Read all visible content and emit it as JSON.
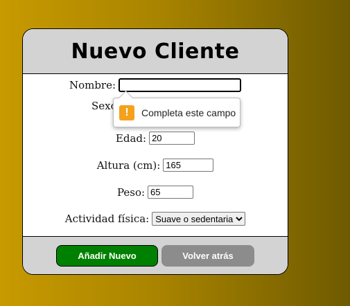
{
  "form": {
    "title": "Nuevo Cliente",
    "fields": {
      "nombre": {
        "label": "Nombre:",
        "value": ""
      },
      "sexo": {
        "label": "Sexo"
      },
      "edad": {
        "label": "Edad:",
        "value": "20"
      },
      "altura": {
        "label": "Altura (cm):",
        "value": "165"
      },
      "peso": {
        "label": "Peso:",
        "value": "65"
      },
      "actividad": {
        "label": "Actividad física:",
        "selected": "Suave o sedentaria"
      }
    },
    "validation_tooltip": {
      "icon": "warning-icon",
      "text": "Completa este campo",
      "color": "#f4a11c"
    }
  },
  "footer": {
    "add_label": "Añadir Nuevo",
    "back_label": "Volver atrás"
  },
  "colors": {
    "primary_button": "#008000",
    "secondary_button": "#8c8c8c",
    "header_bg": "#d3d3d3"
  }
}
